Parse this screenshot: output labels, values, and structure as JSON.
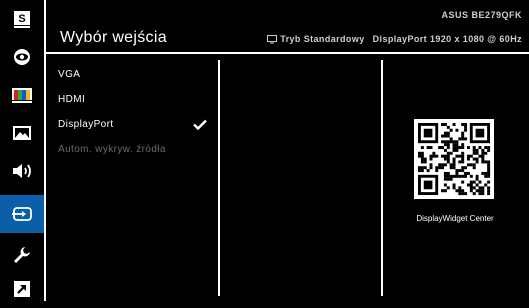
{
  "header": {
    "title": "Wybór wejścia",
    "model": "ASUS BE279QFK",
    "mode": "Tryb Standardowy",
    "input_info": "DisplayPort 1920 x 1080 @ 60Hz"
  },
  "sidebar": {
    "items": [
      {
        "name": "splendid",
        "icon": "s-logo-icon",
        "glyph": "S"
      },
      {
        "name": "eye-care",
        "icon": "eye-icon"
      },
      {
        "name": "color",
        "icon": "color-bars-icon"
      },
      {
        "name": "image",
        "icon": "image-icon"
      },
      {
        "name": "sound",
        "icon": "speaker-icon"
      },
      {
        "name": "input-select",
        "icon": "input-icon",
        "active": true
      },
      {
        "name": "system-setup",
        "icon": "wrench-icon"
      },
      {
        "name": "shortcut",
        "icon": "shortcut-arrow-icon"
      }
    ]
  },
  "menu": {
    "items": [
      {
        "label": "VGA"
      },
      {
        "label": "HDMI"
      },
      {
        "label": "DisplayPort",
        "selected": true
      },
      {
        "label": "Autom. wykryw. źródła",
        "disabled": true
      }
    ]
  },
  "qr": {
    "caption": "DisplayWidget Center"
  },
  "colors": {
    "accent": "#0b5fa8",
    "background": "#000000",
    "text": "#ffffff",
    "disabled_text": "#6a6a6a"
  }
}
